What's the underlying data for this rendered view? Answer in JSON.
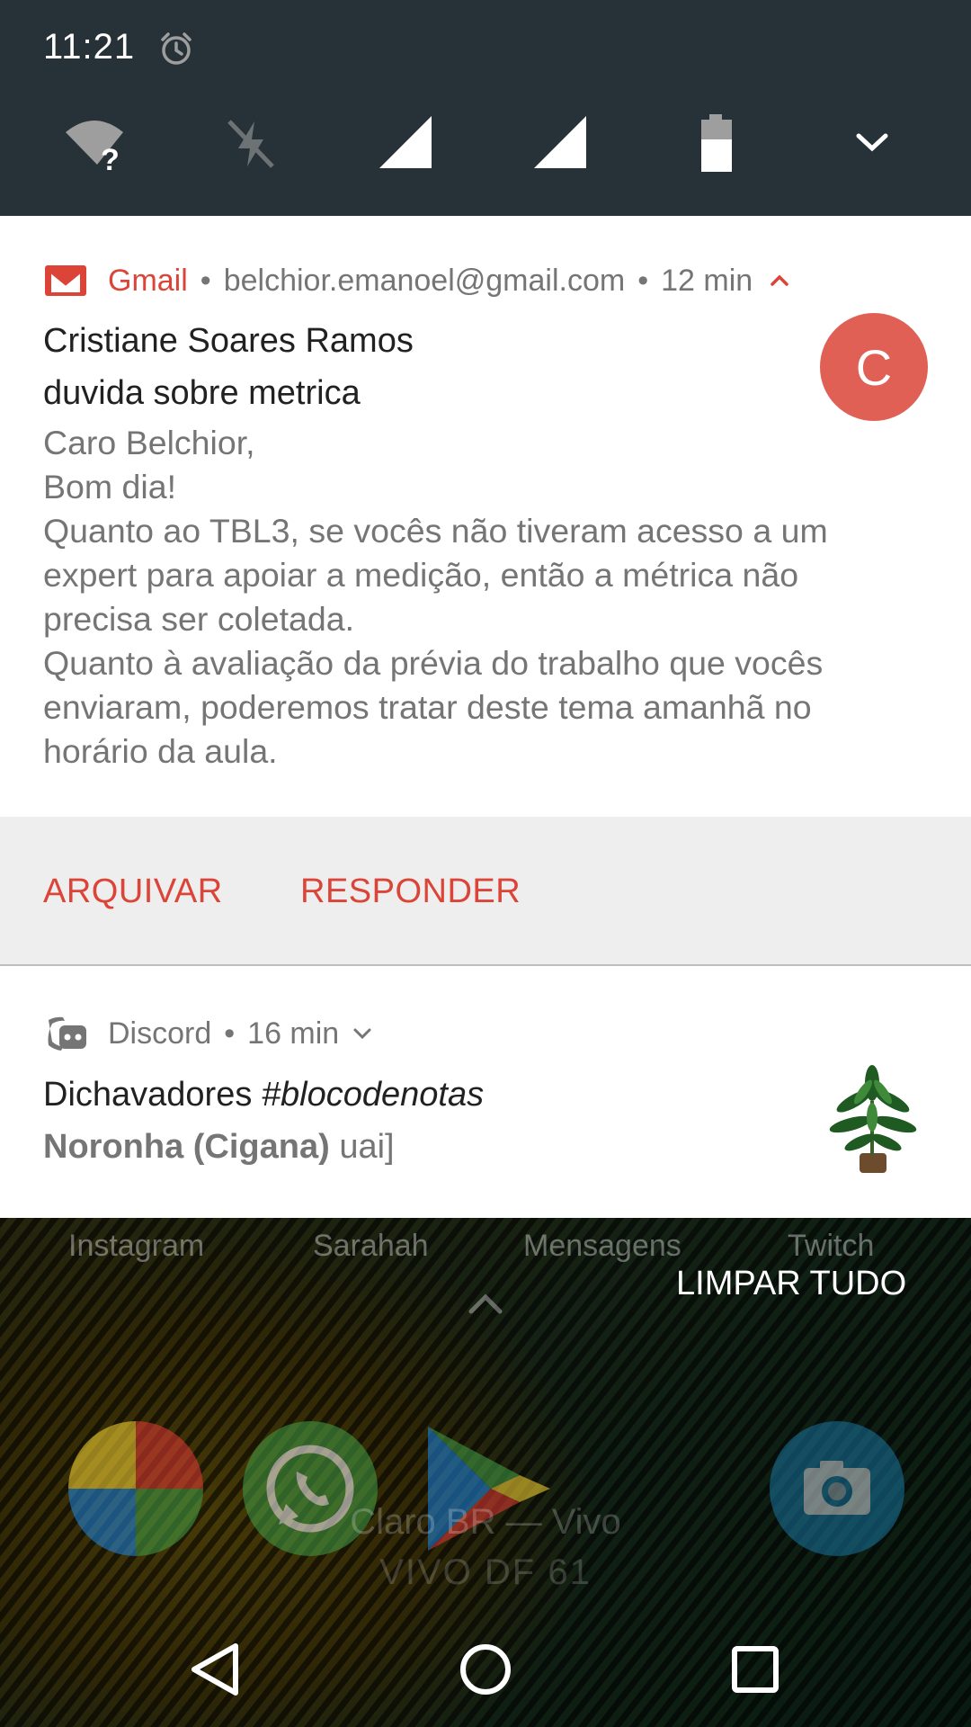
{
  "status": {
    "time": "11:21",
    "icons": [
      "alarm-icon",
      "wifi-unknown-icon",
      "mobile-data-off-icon",
      "signal-icon",
      "signal-icon",
      "battery-icon",
      "expand-chevron-icon"
    ]
  },
  "gmail": {
    "app_name": "Gmail",
    "separator": "•",
    "account": "belchior.emanoel@gmail.com",
    "time": "12 min",
    "sender": "Cristiane Soares Ramos",
    "subject": "duvida sobre metrica",
    "avatar_letter": "C",
    "body_lines": [
      "Caro Belchior,",
      "Bom dia!",
      "Quanto ao TBL3, se vocês não tiveram acesso a um",
      "expert para apoiar a medição, então a métrica não",
      "precisa ser coletada.",
      "Quanto à avaliação da prévia do trabalho que vocês",
      "enviaram, poderemos tratar deste tema amanhã no",
      "horário da aula."
    ],
    "actions": {
      "archive": "ARQUIVAR",
      "reply": "RESPONDER"
    },
    "accent_color": "#db4437"
  },
  "discord": {
    "app_name": "Discord",
    "separator": "•",
    "time": "16 min",
    "server": "Dichavadores",
    "channel": "#blocodenotas",
    "author": "Noronha (Cigana)",
    "message": "uai]"
  },
  "home": {
    "dock_labels": [
      "Instagram",
      "Sarahah",
      "Mensagens",
      "Twitch"
    ],
    "clear_all": "LIMPAR TUDO",
    "carrier_line1": "Claro BR — Vivo",
    "carrier_line2": "VIVO DF 61",
    "app_icons": [
      "photos-icon",
      "whatsapp-icon",
      "play-store-icon",
      "camera-icon"
    ]
  },
  "navigation": [
    "back-icon",
    "home-icon",
    "recents-icon"
  ]
}
